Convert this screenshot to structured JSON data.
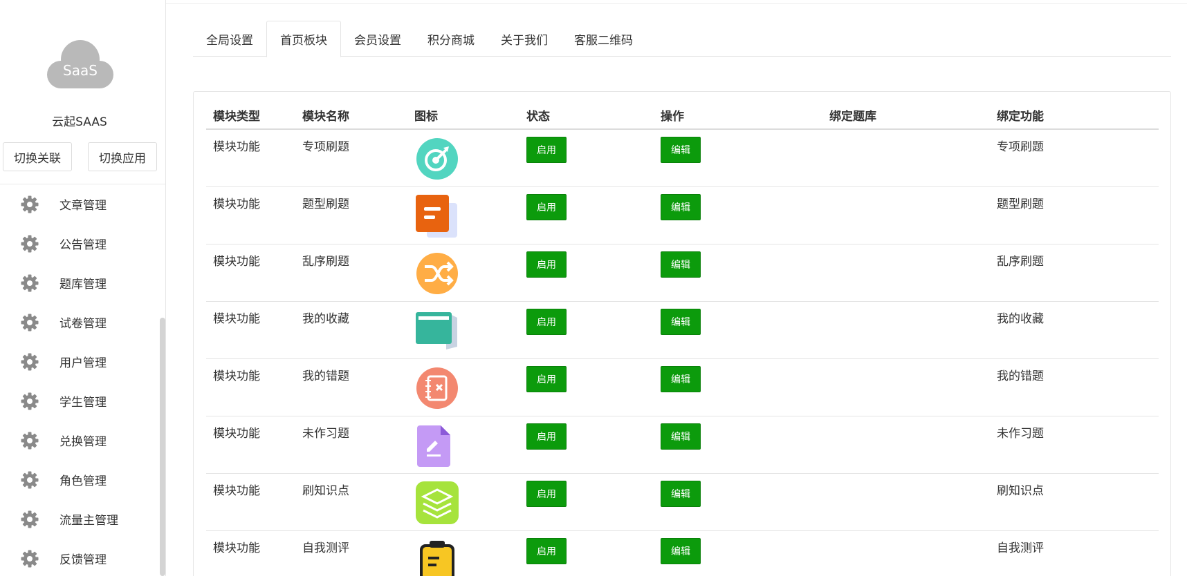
{
  "sidebar": {
    "logo_text": "SaaS",
    "org_name": "云起SAAS",
    "switch_link_label": "切换关联",
    "switch_app_label": "切换应用",
    "menu": [
      {
        "label": "文章管理",
        "icon": "gear-icon"
      },
      {
        "label": "公告管理",
        "icon": "gear-icon"
      },
      {
        "label": "题库管理",
        "icon": "gear-icon"
      },
      {
        "label": "试卷管理",
        "icon": "gear-icon"
      },
      {
        "label": "用户管理",
        "icon": "gear-icon"
      },
      {
        "label": "学生管理",
        "icon": "gear-icon"
      },
      {
        "label": "兑换管理",
        "icon": "gear-icon"
      },
      {
        "label": "角色管理",
        "icon": "gear-icon"
      },
      {
        "label": "流量主管理",
        "icon": "gear-icon"
      },
      {
        "label": "反馈管理",
        "icon": "gear-icon"
      }
    ]
  },
  "tabs": [
    {
      "label": "全局设置",
      "active": false
    },
    {
      "label": "首页板块",
      "active": true
    },
    {
      "label": "会员设置",
      "active": false
    },
    {
      "label": "积分商城",
      "active": false
    },
    {
      "label": "关于我们",
      "active": false
    },
    {
      "label": "客服二维码",
      "active": false
    }
  ],
  "table": {
    "headers": [
      "模块类型",
      "模块名称",
      "图标",
      "状态",
      "操作",
      "绑定题库",
      "绑定功能"
    ],
    "rows": [
      {
        "type": "模块功能",
        "name": "专项刷题",
        "icon": "target-icon",
        "status": "启用",
        "action": "编辑",
        "bank": "",
        "func": "专项刷题"
      },
      {
        "type": "模块功能",
        "name": "题型刷题",
        "icon": "document-stack-icon",
        "status": "启用",
        "action": "编辑",
        "bank": "",
        "func": "题型刷题"
      },
      {
        "type": "模块功能",
        "name": "乱序刷题",
        "icon": "shuffle-icon",
        "status": "启用",
        "action": "编辑",
        "bank": "",
        "func": "乱序刷题"
      },
      {
        "type": "模块功能",
        "name": "我的收藏",
        "icon": "folder-icon",
        "status": "启用",
        "action": "编辑",
        "bank": "",
        "func": "我的收藏"
      },
      {
        "type": "模块功能",
        "name": "我的错题",
        "icon": "wrong-notebook-icon",
        "status": "启用",
        "action": "编辑",
        "bank": "",
        "func": "我的错题"
      },
      {
        "type": "模块功能",
        "name": "未作习题",
        "icon": "edit-file-icon",
        "status": "启用",
        "action": "编辑",
        "bank": "",
        "func": "未作习题"
      },
      {
        "type": "模块功能",
        "name": "刷知识点",
        "icon": "layers-icon",
        "status": "启用",
        "action": "编辑",
        "bank": "",
        "func": "刷知识点"
      },
      {
        "type": "模块功能",
        "name": "自我测评",
        "icon": "clipboard-icon",
        "status": "启用",
        "action": "编辑",
        "bank": "",
        "func": "自我测评"
      }
    ]
  },
  "colors": {
    "button_green": "#0c9b0c",
    "logo_grey": "#b9b9b9"
  }
}
